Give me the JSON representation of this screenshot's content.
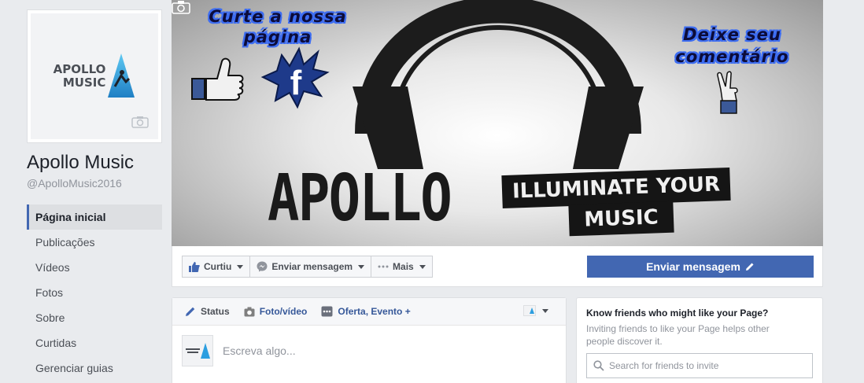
{
  "page": {
    "name": "Apollo Music",
    "handle": "@ApolloMusic2016",
    "logo_line1": "APOLLO",
    "logo_line2": "MUSIC"
  },
  "sidebar": {
    "items": [
      {
        "label": "Página inicial",
        "active": true
      },
      {
        "label": "Publicações",
        "active": false
      },
      {
        "label": "Vídeos",
        "active": false
      },
      {
        "label": "Fotos",
        "active": false
      },
      {
        "label": "Sobre",
        "active": false
      },
      {
        "label": "Curtidas",
        "active": false
      },
      {
        "label": "Gerenciar guias",
        "active": false
      }
    ]
  },
  "cover": {
    "left_text_line1": "Curte a nossa",
    "left_text_line2": "página",
    "right_text_line1": "Deixe seu",
    "right_text_line2": "comentário",
    "brand": "APOLLO",
    "banner_line1": "ILLUMINATE YOUR",
    "banner_line2": "MUSIC",
    "facebook_letter": "f"
  },
  "actions": {
    "like_label": "Curtiu",
    "message_label": "Enviar mensagem",
    "more_label": "Mais",
    "primary_label": "Enviar mensagem"
  },
  "composer": {
    "tab_status": "Status",
    "tab_photo": "Foto/vídeo",
    "tab_offer": "Oferta, Evento +",
    "placeholder": "Escreva algo..."
  },
  "invite": {
    "title": "Know friends who might like your Page?",
    "description": "Inviting friends to like your Page helps other people discover it.",
    "search_placeholder": "Search for friends to invite"
  },
  "colors": {
    "brand_blue": "#4267b2",
    "link_blue": "#365899",
    "page_bg": "#e9ebee"
  }
}
